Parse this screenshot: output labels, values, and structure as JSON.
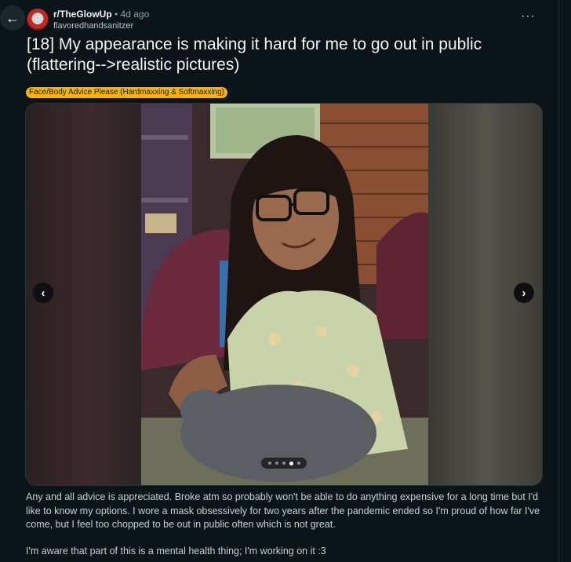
{
  "post": {
    "subreddit": "r/TheGlowUp",
    "age": "• 4d ago",
    "author": "flavoredhandsanitzer",
    "title": "[18] My appearance is making it hard for me to go out in public (flattering-->realistic pictures)",
    "flair": "Face/Body Advice Please (Hardmaxxing & Softmaxxing)",
    "body_p1": "Any and all advice is appreciated. Broke atm so probably won't be able to do anything expensive for a long time but I'd like to know my options. I wore a mask obsessively for two years after the pandemic ended so I'm proud of how far I've come, but I feel too chopped to be out in public often which is not great.",
    "body_p2": "I'm aware that part of this is a mental health thing; I'm working on it :3"
  },
  "icons": {
    "back": "←",
    "more": "···",
    "prev": "‹",
    "next": "›"
  },
  "gallery": {
    "image_count": 5,
    "active_index": 3
  },
  "colors": {
    "background": "#0b1416",
    "flair": "#f6b400",
    "text": "#f2f4f5",
    "muted": "#8ba2ad"
  }
}
